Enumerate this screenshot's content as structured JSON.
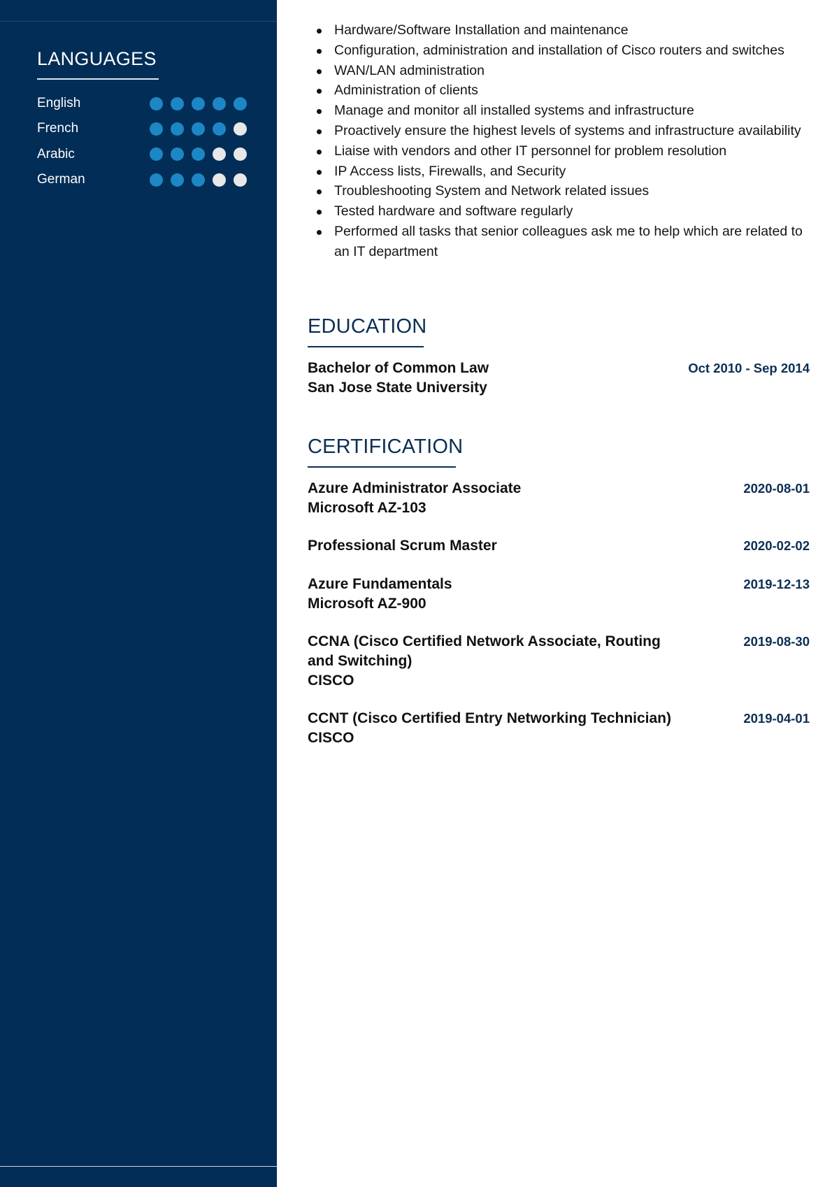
{
  "sidebar": {
    "languages": {
      "heading": "LANGUAGES",
      "max_level": 5,
      "items": [
        {
          "name": "English",
          "level": 5
        },
        {
          "name": "French",
          "level": 4
        },
        {
          "name": "Arabic",
          "level": 3
        },
        {
          "name": "German",
          "level": 3
        }
      ]
    }
  },
  "experience": {
    "bullets": [
      "Hardware/Software Installation and maintenance",
      "Configuration, administration and installation of Cisco routers and switches",
      "WAN/LAN administration",
      "Administration of clients",
      "Manage and monitor all installed systems and infrastructure",
      "Proactively ensure the highest levels of systems and infrastructure availability",
      "Liaise with vendors and other IT personnel for problem resolution",
      "IP Access lists, Firewalls, and Security",
      "Troubleshooting System and Network related issues",
      "Tested hardware and software regularly",
      "Performed all tasks that senior colleagues ask me to help which are related to an IT department"
    ]
  },
  "education": {
    "heading": "EDUCATION",
    "items": [
      {
        "degree": "Bachelor of Common Law",
        "school": "San Jose State University",
        "dates": "Oct 2010 - Sep 2014"
      }
    ]
  },
  "certification": {
    "heading": "CERTIFICATION",
    "items": [
      {
        "title": "Azure Administrator Associate",
        "issuer": "Microsoft AZ-103",
        "date": "2020-08-01"
      },
      {
        "title": "Professional Scrum Master",
        "issuer": "",
        "date": "2020-02-02"
      },
      {
        "title": "Azure Fundamentals",
        "issuer": "Microsoft AZ-900",
        "date": "2019-12-13"
      },
      {
        "title": "CCNA (Cisco Certified Network Associate, Routing and Switching)",
        "issuer": "CISCO",
        "date": "2019-08-30"
      },
      {
        "title": "CCNT (Cisco Certified Entry Networking Technician)",
        "issuer": "CISCO",
        "date": "2019-04-01"
      }
    ]
  },
  "colors": {
    "sidebar_bg": "#012d57",
    "accent_dot": "#1d87c6",
    "inactive_dot": "#e8e8e8",
    "heading_blue": "#0b2e55"
  }
}
